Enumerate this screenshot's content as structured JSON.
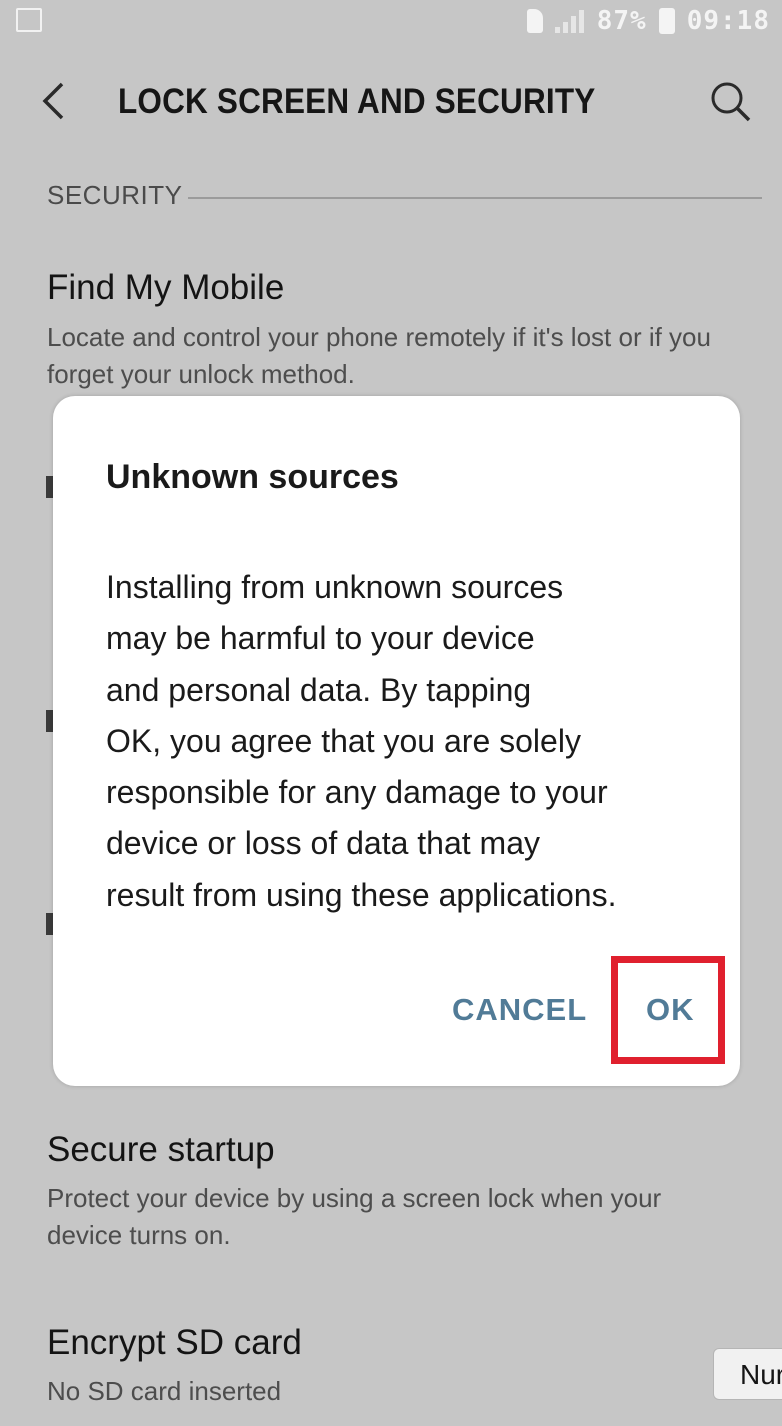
{
  "status_bar": {
    "battery_percent": "87%",
    "time": "09:18",
    "icons": [
      "notification-icon",
      "sim-icon",
      "signal-icon",
      "battery-icon"
    ]
  },
  "app_bar": {
    "back_icon": "chevron-left-icon",
    "title": "LOCK SCREEN AND SECURITY",
    "search_icon": "search-icon"
  },
  "section_header": "SECURITY",
  "items": [
    {
      "title": "Find My Mobile",
      "subtitle": "Locate and control your phone remotely if it's lost or if you forget your unlock method."
    },
    {
      "title": "Secure startup",
      "subtitle": "Protect your device by using a screen lock when your device turns on."
    },
    {
      "title": "Encrypt SD card",
      "subtitle": "No SD card inserted"
    }
  ],
  "dialog": {
    "title": "Unknown sources",
    "message": "Installing from unknown sources\nmay be harmful to your device\nand personal data. By tapping\nOK, you agree that you are solely\nresponsible for any damage to your\ndevice or loss of data that may\nresult from using these applications.",
    "cancel_label": "CANCEL",
    "ok_label": "OK"
  },
  "side_pill_label": "Nur",
  "colors": {
    "dim_background": "#c6c6c6",
    "dialog_button": "#517b97",
    "highlight": "#e0202e"
  }
}
